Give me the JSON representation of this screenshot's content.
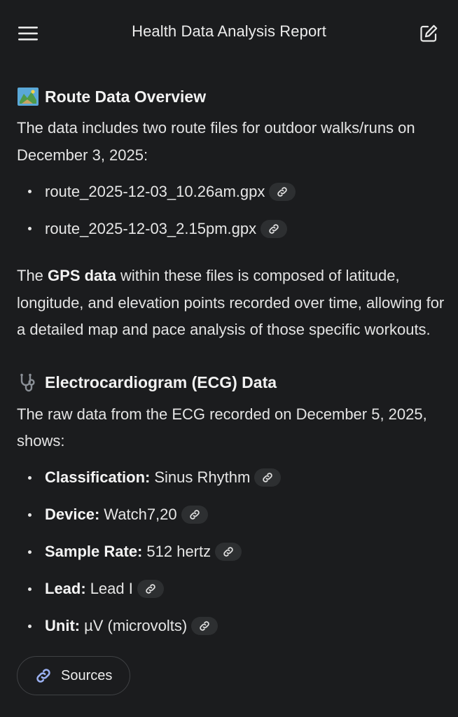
{
  "header": {
    "title": "Health Data Analysis Report",
    "menu_icon": "hamburger-menu-icon",
    "edit_icon": "edit-note-icon"
  },
  "route_section": {
    "emoji": "map-emoji",
    "heading": "Route Data Overview",
    "intro": "The data includes two route files for outdoor walks/runs on December 3, 2025:",
    "files": [
      "route_2025-12-03_10.26am.gpx",
      "route_2025-12-03_2.15pm.gpx"
    ],
    "gps_pre": "The ",
    "gps_bold": "GPS data",
    "gps_post": " within these files is composed of latitude, longitude, and elevation points recorded over time, allowing for a detailed map and pace analysis of those specific workouts."
  },
  "ecg_section": {
    "emoji": "stethoscope-emoji",
    "heading": "Electrocardiogram (ECG) Data",
    "intro": "The raw data from the ECG recorded on December 5, 2025, shows:",
    "items": [
      {
        "label": "Classification:",
        "value": "Sinus Rhythm"
      },
      {
        "label": "Device:",
        "value": "Watch7,20"
      },
      {
        "label": "Sample Rate:",
        "value": "512 hertz"
      },
      {
        "label": "Lead:",
        "value": "Lead I"
      },
      {
        "label": "Unit:",
        "value": "µV (microvolts)"
      }
    ]
  },
  "sources_button": {
    "label": "Sources",
    "icon": "link-icon"
  },
  "colors": {
    "background": "#1b1c1e",
    "text": "#e6e6e6",
    "chip": "#2d2f31",
    "link_icon": "#9ab0f0"
  }
}
